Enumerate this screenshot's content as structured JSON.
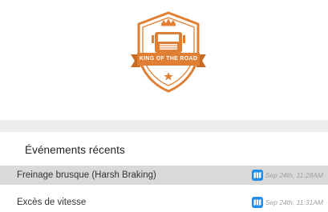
{
  "badge": {
    "title": "KING OF THE ROAD",
    "color": "#e07f33"
  },
  "events_section": {
    "title": "Événements récents",
    "items": [
      {
        "label": "Freinage brusque (Harsh Braking)",
        "time": "Sep 24th, 11:28AM",
        "icon": "map-icon"
      },
      {
        "label": "Excès de vitesse",
        "time": "Sep 24th, 11:31AM",
        "icon": "map-icon"
      }
    ]
  },
  "colors": {
    "accent": "#e07f33",
    "map_icon": "#1f8ee8",
    "selected_row": "#d9d9d9"
  }
}
